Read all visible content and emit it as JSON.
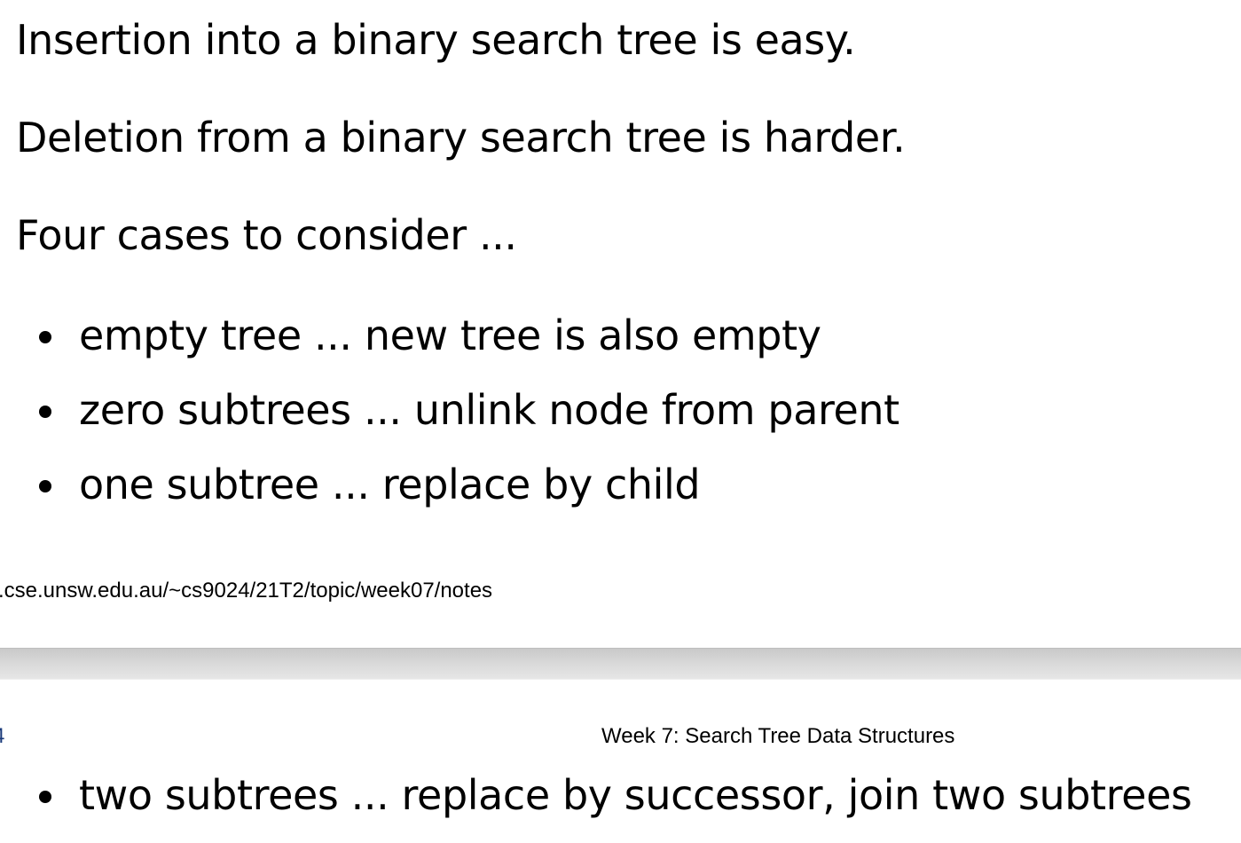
{
  "page1": {
    "paragraphs": [
      "Insertion into a binary search tree is easy.",
      "Deletion from a binary search tree is harder.",
      "Four cases to consider ..."
    ],
    "bullets": [
      "empty tree ... new tree is also empty",
      "zero subtrees ... unlink node from parent",
      "one subtree ... replace by child"
    ],
    "footer_url": ".cse.unsw.edu.au/~cs9024/21T2/topic/week07/notes"
  },
  "page2": {
    "header_page_number": "4",
    "header_title": "Week 7: Search Tree Data Structures",
    "bullets": [
      "two subtrees ... replace by successor, join two subtrees"
    ]
  }
}
